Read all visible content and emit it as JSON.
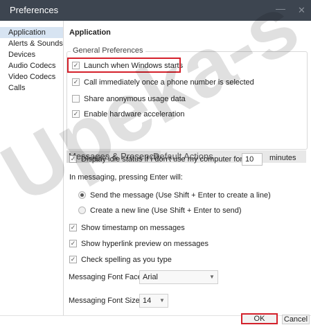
{
  "window": {
    "title": "Preferences",
    "minimize_glyph": "—",
    "close_glyph": "✕"
  },
  "sidebar": {
    "items": [
      {
        "label": "Application",
        "selected": true
      },
      {
        "label": "Alerts & Sounds",
        "selected": false
      },
      {
        "label": "Devices",
        "selected": false
      },
      {
        "label": "Audio Codecs",
        "selected": false
      },
      {
        "label": "Video Codecs",
        "selected": false
      },
      {
        "label": "Calls",
        "selected": false
      }
    ]
  },
  "main": {
    "heading": "Application",
    "general": {
      "legend": "General Preferences",
      "options": [
        {
          "label": "Launch when Windows starts",
          "checked": true
        },
        {
          "label": "Call immediately once a phone number is selected",
          "checked": true
        },
        {
          "label": "Share anonymous usage data",
          "checked": false
        },
        {
          "label": "Enable hardware acceleration",
          "checked": true
        }
      ]
    },
    "tabs": {
      "active": "Messages & Presence",
      "other": "Default Actions"
    },
    "messages": {
      "idle_label": "Display idle status if I don't use my computer for:",
      "idle_checked": true,
      "idle_value": "10",
      "idle_unit": "minutes",
      "enter_label": "In messaging, pressing Enter will:",
      "radios": [
        {
          "label": "Send the message (Use Shift + Enter to create a line)",
          "selected": true
        },
        {
          "label": "Create a new line (Use Shift + Enter to send)",
          "selected": false
        }
      ],
      "checks": [
        {
          "label": "Show timestamp on messages",
          "checked": true
        },
        {
          "label": "Show hyperlink preview on messages",
          "checked": true
        },
        {
          "label": "Check spelling as you type",
          "checked": true
        }
      ],
      "font_face_label": "Messaging Font Face:",
      "font_face_value": "Arial",
      "font_size_label": "Messaging Font Size:",
      "font_size_value": "14"
    }
  },
  "buttons": {
    "ok": "OK",
    "cancel": "Cancel"
  },
  "watermark": {
    "text": "Upeka-s"
  },
  "colors": {
    "titlebar": "#3d4550",
    "highlight": "#d4202a",
    "selection": "#d7e4f2"
  }
}
